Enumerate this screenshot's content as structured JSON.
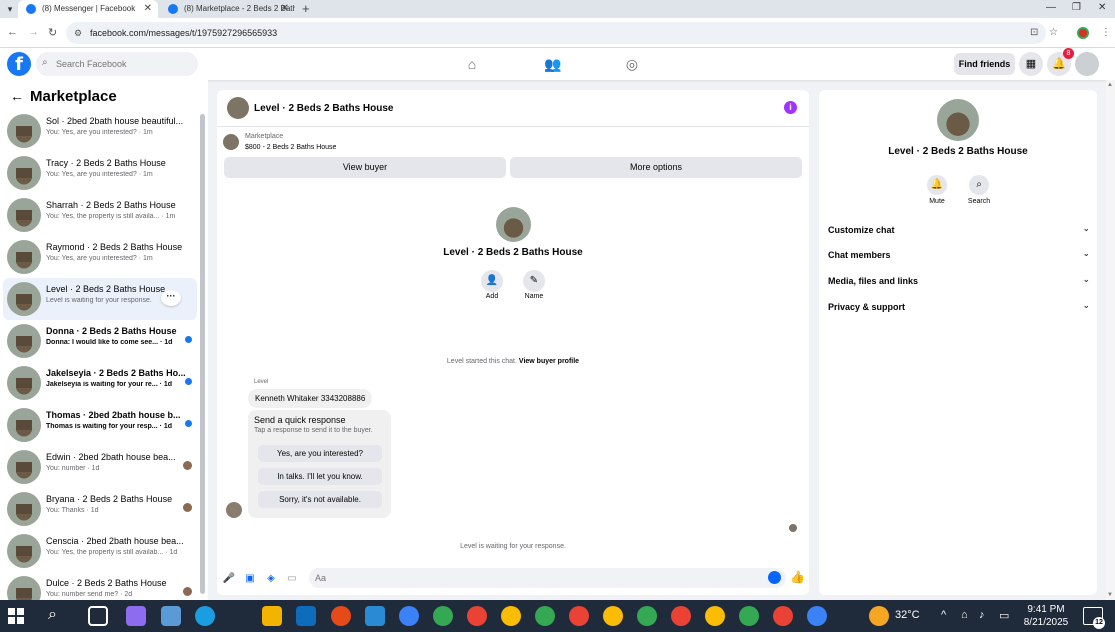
{
  "browser": {
    "tabs": [
      {
        "title": "(8) Messenger | Facebook",
        "active": true
      },
      {
        "title": "(8) Marketplace - 2 Beds 2 Bath",
        "active": false
      }
    ],
    "url": "facebook.com/messages/t/1975927296565933"
  },
  "fb": {
    "search_placeholder": "Search Facebook",
    "find_friends": "Find friends",
    "notification_count": "8"
  },
  "sidebar": {
    "title": "Marketplace",
    "conversations": [
      {
        "title": "Sol · 2bed 2bath house beautiful...",
        "sub": "You: Yes, are you interested? · 1m",
        "unread": false,
        "indicator": "none"
      },
      {
        "title": "Tracy · 2 Beds 2 Baths House",
        "sub": "You: Yes, are you interested? · 1m",
        "unread": false,
        "indicator": "none"
      },
      {
        "title": "Sharrah · 2 Beds 2 Baths House",
        "sub": "You: Yes, the property is still availa... · 1m",
        "unread": false,
        "indicator": "none"
      },
      {
        "title": "Raymond · 2 Beds 2 Baths House",
        "sub": "You: Yes, are you interested? · 1m",
        "unread": false,
        "indicator": "none"
      },
      {
        "title": "Level · 2 Beds 2 Baths House",
        "sub": "Level is waiting for your response.",
        "unread": false,
        "indicator": "more",
        "selected": true
      },
      {
        "title": "Donna · 2 Beds 2 Baths House",
        "sub": "Donna: I would like to come see... · 1d",
        "unread": true,
        "indicator": "dot"
      },
      {
        "title": "Jakelseyia · 2 Beds 2 Baths Ho...",
        "sub": "Jakelseyia is waiting for your re... · 1d",
        "unread": true,
        "indicator": "dot"
      },
      {
        "title": "Thomas · 2bed 2bath house b...",
        "sub": "Thomas is waiting for your resp... · 1d",
        "unread": true,
        "indicator": "dot"
      },
      {
        "title": "Edwin · 2bed 2bath house bea...",
        "sub": "You: number · 1d",
        "unread": false,
        "indicator": "avatar"
      },
      {
        "title": "Bryana · 2 Beds 2 Baths House",
        "sub": "You: Thanks · 1d",
        "unread": false,
        "indicator": "avatar"
      },
      {
        "title": "Censcia · 2bed 2bath house bea...",
        "sub": "You: Yes, the property is still availab... · 1d",
        "unread": false,
        "indicator": "none"
      },
      {
        "title": "Dulce · 2 Beds 2 Baths House",
        "sub": "You: number send me? · 2d",
        "unread": false,
        "indicator": "avatar"
      }
    ]
  },
  "chat": {
    "title": "Level · 2 Beds 2 Baths House",
    "marketplace_label": "Marketplace",
    "listing": "$800 - 2 Beds 2 Baths House",
    "view_buyer": "View buyer",
    "more_options": "More options",
    "intro_title": "Level · 2 Beds 2 Baths House",
    "add_label": "Add",
    "name_label": "Name",
    "started_text": "Level started this chat.",
    "view_buyer_profile": "View buyer profile",
    "sender": "Level",
    "message": "Kenneth Whitaker 3343208886",
    "quick_title": "Send a quick response",
    "quick_sub": "Tap a response to send it to the buyer.",
    "quick_responses": [
      "Yes, are you interested?",
      "In talks. I'll let you know.",
      "Sorry, it's not available."
    ],
    "waiting_text": "Level is waiting for your response.",
    "composer_placeholder": "Aa"
  },
  "details": {
    "title": "Level · 2 Beds 2 Baths House",
    "mute": "Mute",
    "search": "Search",
    "sections": [
      "Customize chat",
      "Chat members",
      "Media, files and links",
      "Privacy & support"
    ]
  },
  "taskbar": {
    "temperature": "32°C",
    "time": "9:41 PM",
    "date": "8/21/2025",
    "notif_count": "12"
  }
}
